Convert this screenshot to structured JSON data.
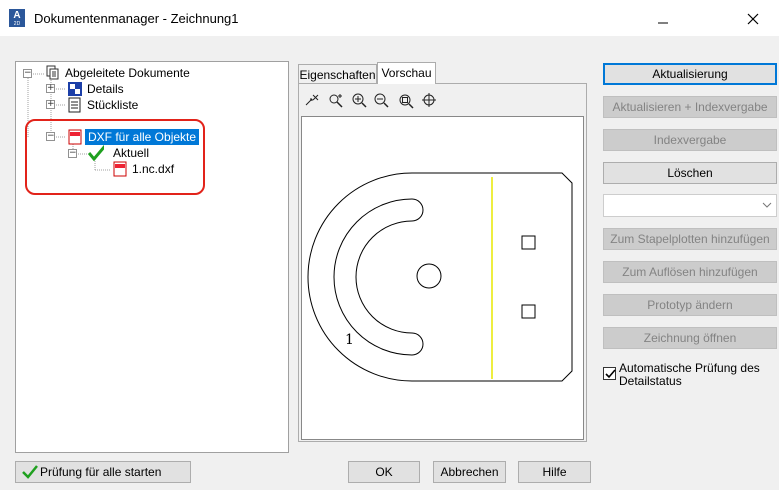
{
  "window": {
    "title": "Dokumentenmanager - Zeichnung1",
    "icon_letter": "A",
    "icon_sub": "2D"
  },
  "tree": {
    "items": [
      {
        "label": "Abgeleitete Dokumente"
      },
      {
        "label": "Details"
      },
      {
        "label": "Stückliste"
      },
      {
        "label": "DXF für alle Objekte"
      },
      {
        "label": "Aktuell"
      },
      {
        "label": "1.nc.dxf"
      }
    ]
  },
  "tabs": [
    {
      "label": "Eigenschaften",
      "active": false
    },
    {
      "label": "Vorschau",
      "active": true
    }
  ],
  "preview_toolbar": [
    "pan-icon",
    "zoom-realtime-icon",
    "zoom-in-icon",
    "zoom-out-icon",
    "zoom-window-icon",
    "zoom-extents-icon"
  ],
  "preview": {
    "part_label": "1"
  },
  "right_buttons": {
    "aktualisierung": "Aktualisierung",
    "aktualisieren_index": "Aktualisieren + Indexvergabe",
    "indexvergabe": "Indexvergabe",
    "loeschen": "Löschen",
    "stapelplotten": "Zum Stapelplotten hinzufügen",
    "aufloesen": "Zum Auflösen hinzufügen",
    "prototyp": "Prototyp ändern",
    "zeichnung_oeffnen": "Zeichnung öffnen"
  },
  "auto_check": {
    "label": "Automatische Prüfung des Detailstatus",
    "checked": true
  },
  "bottom": {
    "pruefung": "Prüfung für alle starten",
    "ok": "OK",
    "abbrechen": "Abbrechen",
    "hilfe": "Hilfe"
  },
  "colors": {
    "selection": "#0078d7",
    "highlight_box": "#e2231a",
    "check_green": "#1fa01f",
    "preview_yellow_line": "#e8e800"
  }
}
